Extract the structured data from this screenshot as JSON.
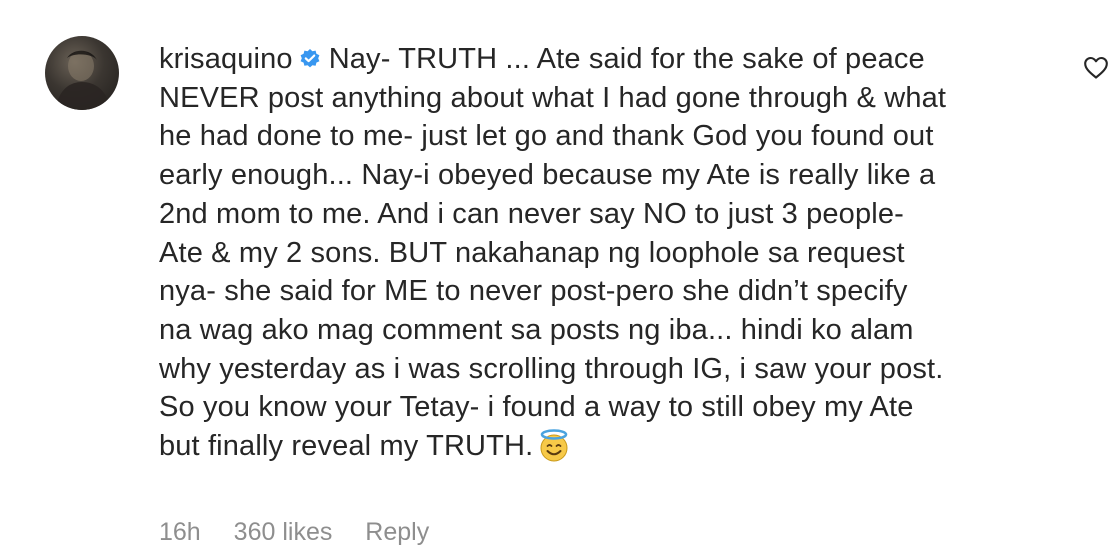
{
  "comment": {
    "avatar_icon": "user-avatar",
    "username": "krisaquino",
    "verified_icon": "verified-badge-icon",
    "verified_color": "#3897f0",
    "lines": [
      "Nay- TRUTH ... Ate said for the sake of peace",
      "NEVER post anything about what I had gone through & what",
      "he had done to me- just let go and thank God you found out",
      "early enough... Nay-i obeyed because my Ate is really like a",
      "2nd mom to me. And i can never say NO to just 3 people-",
      "Ate & my 2 sons. BUT nakahanap ng loophole sa request",
      "nya- she said for ME to never post-pero she didn’t specify",
      "na wag ako mag comment sa posts ng iba... hindi ko alam",
      "why yesterday as i was scrolling through IG, i saw your post.",
      "So you know your Tetay- i found a way to still obey my Ate",
      "but finally reveal my TRUTH."
    ],
    "emoji_icon": "smiling-face-with-halo-emoji",
    "heart_icon": "heart-outline-icon"
  },
  "meta": {
    "time": "16h",
    "likes": "360 likes",
    "reply_label": "Reply"
  }
}
